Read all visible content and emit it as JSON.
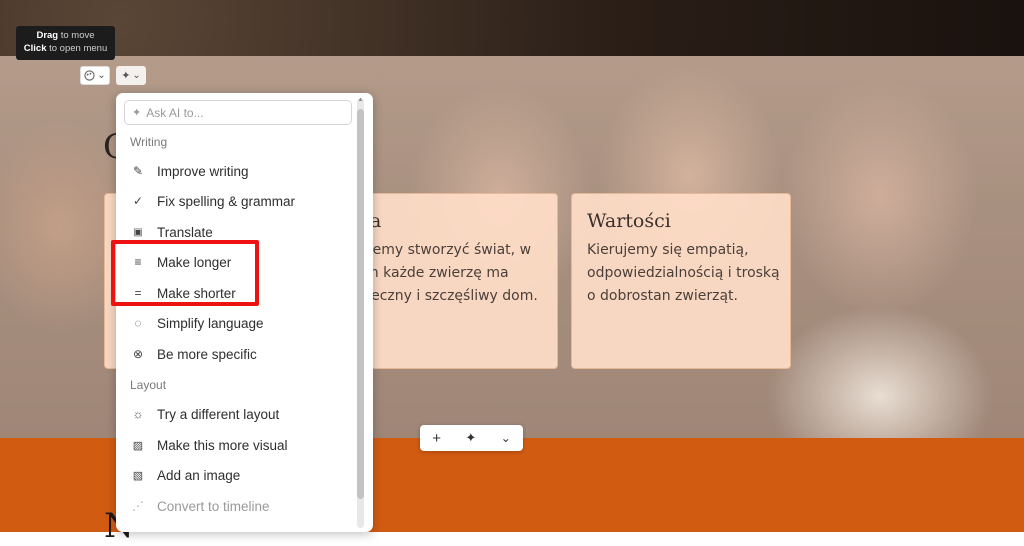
{
  "tooltip": {
    "line1_bold": "Drag",
    "line1_rest": " to move",
    "line2_bold": "Click",
    "line2_rest": " to open menu"
  },
  "toolbar": {
    "palette_icon": "palette-icon",
    "ai_icon": "sparkle-icon",
    "chevron": "⌄"
  },
  "page": {
    "heading_partial": "C",
    "bottom_heading_partial": "N",
    "cards": [
      {
        "title": "",
        "text": ""
      },
      {
        "title": "izja",
        "text": "gniemy stworzyć świat, w rym każde zwierzę ma zpieczny i szczęśliwy dom."
      },
      {
        "title": "Wartości",
        "text": "Kierujemy się empatią, odpowiedzialnością i troską o dobrostan zwierząt."
      }
    ]
  },
  "ai_menu": {
    "ask_placeholder": "Ask AI to...",
    "sections": {
      "writing": "Writing",
      "layout": "Layout"
    },
    "writing_items": [
      {
        "label": "Improve writing",
        "icon": "pen-icon"
      },
      {
        "label": "Fix spelling & grammar",
        "icon": "check-icon"
      },
      {
        "label": "Translate",
        "icon": "translate-icon"
      },
      {
        "label": "Make longer",
        "icon": "lines-icon"
      },
      {
        "label": "Make shorter",
        "icon": "short-lines-icon"
      },
      {
        "label": "Simplify language",
        "icon": "speech-bubble-icon"
      },
      {
        "label": "Be more specific",
        "icon": "specific-icon"
      }
    ],
    "layout_items": [
      {
        "label": "Try a different layout",
        "icon": "lightbulb-icon"
      },
      {
        "label": "Make this more visual",
        "icon": "image-icon"
      },
      {
        "label": "Add an image",
        "icon": "add-image-icon"
      },
      {
        "label": "Convert to timeline",
        "icon": "timeline-icon",
        "disabled": true
      }
    ]
  },
  "floatbar": {
    "add": "+",
    "ai": "✦",
    "more": "⌄"
  },
  "colors": {
    "accent_orange": "#d25b12",
    "card_bg": "#ffddc8",
    "highlight": "#ee1111"
  }
}
